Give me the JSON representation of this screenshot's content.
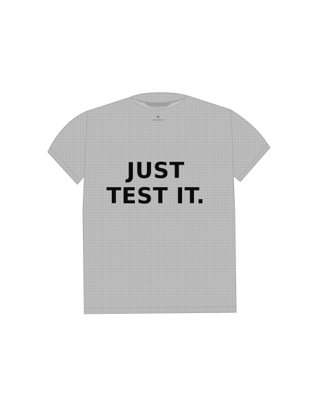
{
  "product": {
    "type": "t-shirt",
    "shirt_color": "#b9b9b9",
    "shirt_shadow_color": "#a9a9a9",
    "print_color": "#0b0b0b",
    "print_lines": [
      "JUST",
      "TEST IT."
    ]
  }
}
